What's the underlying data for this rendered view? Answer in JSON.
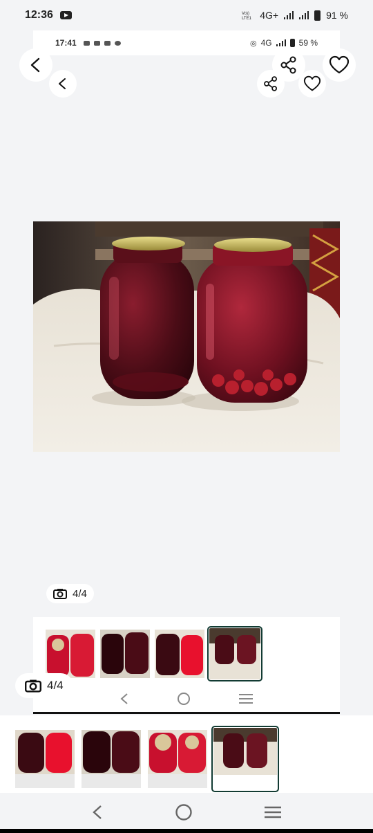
{
  "status_bar": {
    "time": "12:36",
    "net_label": "4G+",
    "battery": "91 %",
    "icons": [
      "youtube-icon",
      "volte-icon",
      "signal-icon",
      "battery-icon"
    ]
  },
  "inner_status_bar": {
    "time": "17:41",
    "net_label": "4G",
    "battery": "59 %"
  },
  "gallery": {
    "photo_alt": "Two jars of cherry compote",
    "counter": "4/4",
    "thumbnails": [
      {
        "name": "thumb-1",
        "colors": [
          "#c8102e",
          "#5a0f1a"
        ]
      },
      {
        "name": "thumb-2",
        "colors": [
          "#3a0a12",
          "#5a0f1a"
        ]
      },
      {
        "name": "thumb-3",
        "colors": [
          "#e8112d",
          "#3a0a12"
        ]
      },
      {
        "name": "thumb-4",
        "colors": [
          "#5a0f1a",
          "#6b1422"
        ],
        "selected": true
      }
    ]
  },
  "colors": {
    "selected_outline": "#123b33",
    "background": "#f3f4f6"
  }
}
